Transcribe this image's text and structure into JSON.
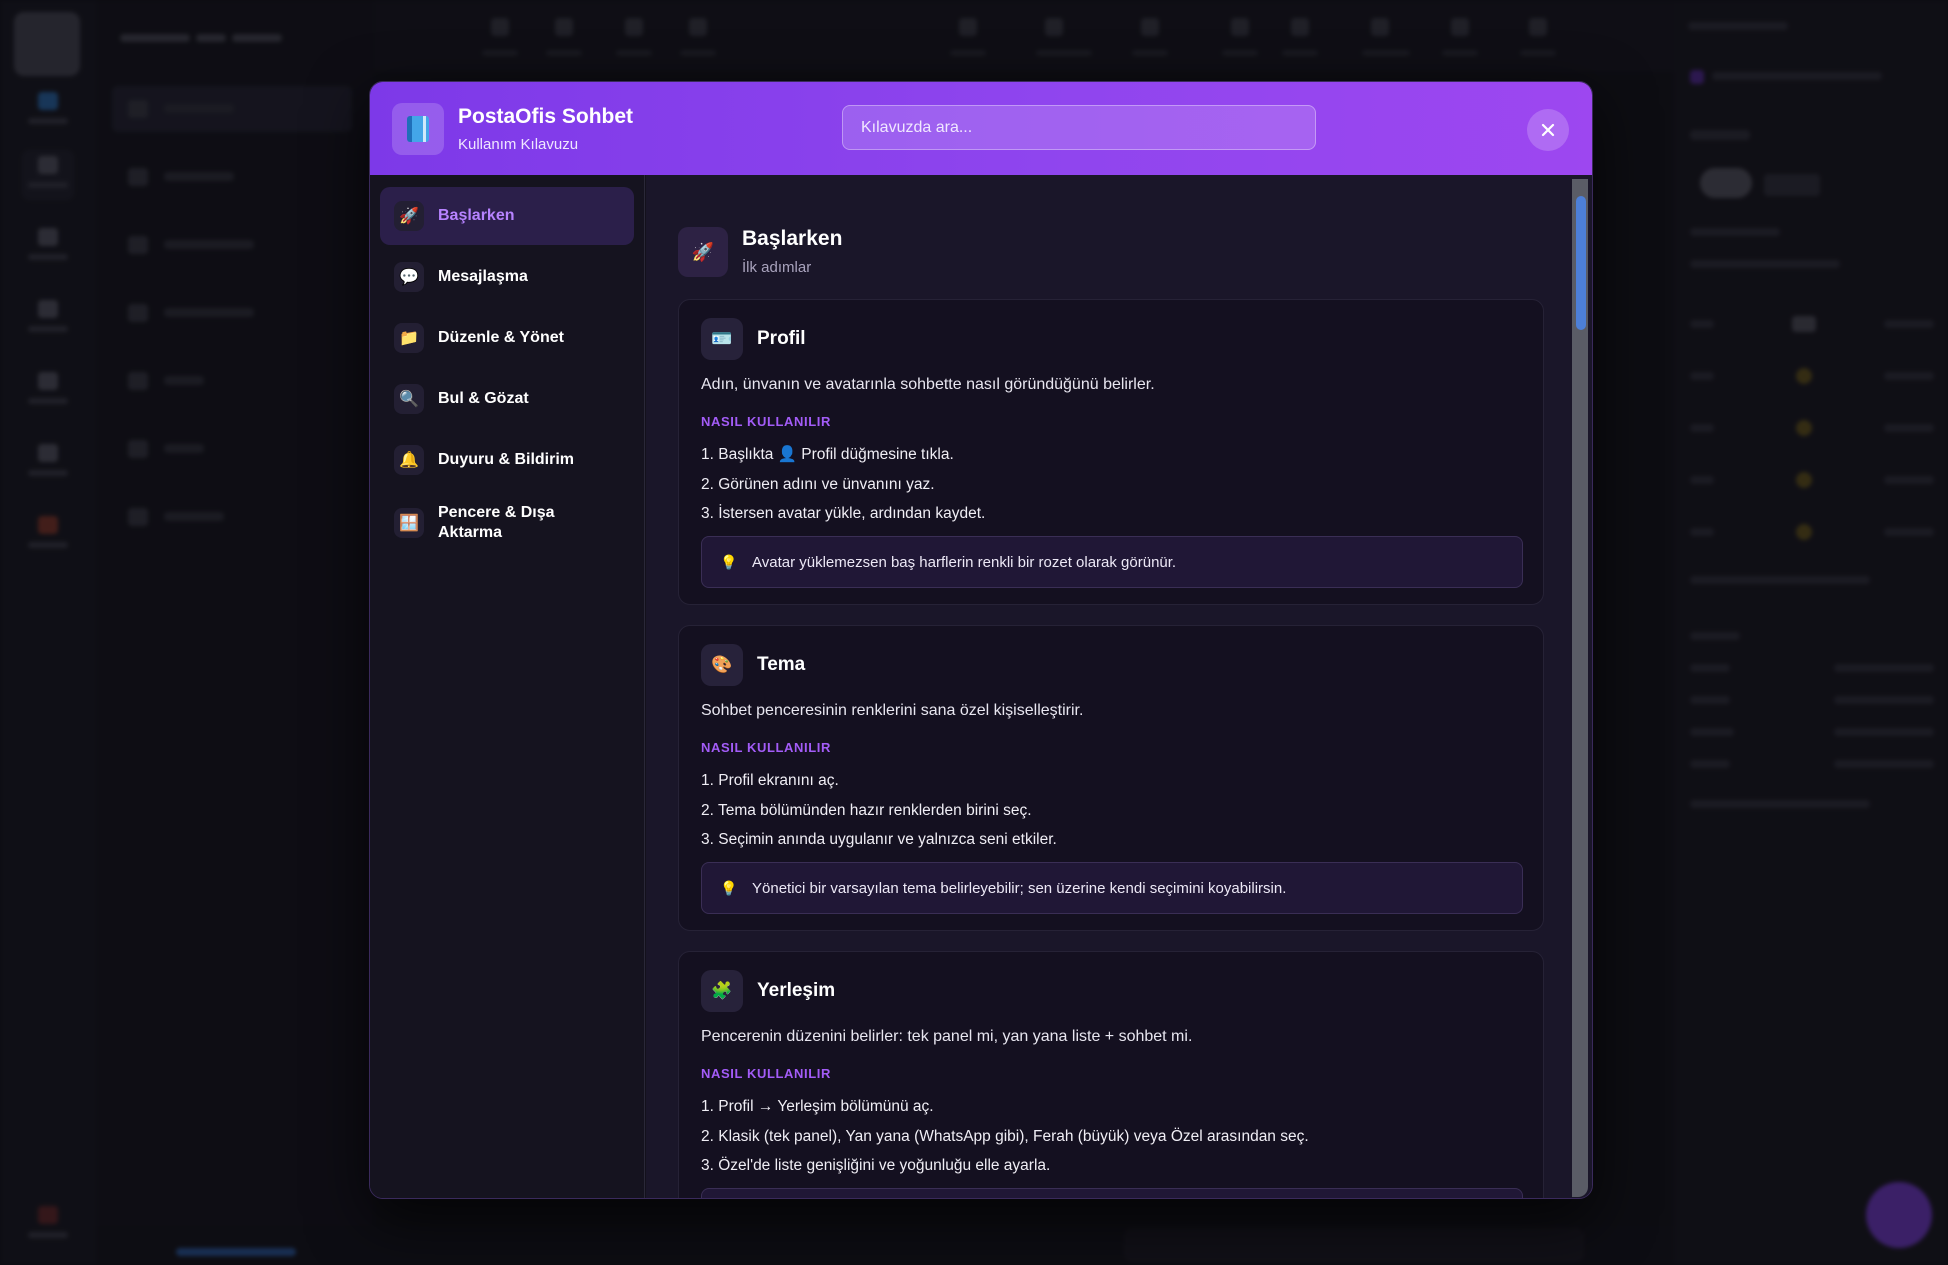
{
  "modal": {
    "title": "PostaOfis Sohbet",
    "subtitle": "Kullanım Kılavuzu",
    "search_placeholder": "Kılavuzda ara...",
    "close_icon": "close-icon",
    "app_icon": "book-icon"
  },
  "nav": [
    {
      "label": "Başlarken",
      "icon": "rocket-icon",
      "glyph": "🚀",
      "active": true
    },
    {
      "label": "Mesajlaşma",
      "icon": "speech-bubble-icon",
      "glyph": "💬",
      "active": false
    },
    {
      "label": "Düzenle & Yönet",
      "icon": "folder-icon",
      "glyph": "📁",
      "active": false
    },
    {
      "label": "Bul & Gözat",
      "icon": "magnifier-icon",
      "glyph": "🔍",
      "active": false
    },
    {
      "label": "Duyuru & Bildirim",
      "icon": "bell-icon",
      "glyph": "🔔",
      "active": false
    },
    {
      "label": "Pencere & Dışa Aktarma",
      "icon": "window-icon",
      "glyph": "🪟",
      "active": false
    }
  ],
  "section": {
    "title": "Başlarken",
    "subtitle": "İlk adımlar",
    "icon": "rocket-icon",
    "glyph": "🚀"
  },
  "cards": [
    {
      "title": "Profil",
      "icon": "id-card-icon",
      "glyph": "🪪",
      "description": "Adın, ünvanın ve avatarınla sohbette nasıl göründüğünü belirler.",
      "howto_label": "NASIL KULLANILIR",
      "steps": [
        "1. Başlıkta 👤 Profil düğmesine tıkla.",
        "2. Görünen adını ve ünvanını yaz.",
        "3. İstersen avatar yükle, ardından kaydet."
      ],
      "tip_icon": "lightbulb-icon",
      "tip": "Avatar yüklemezsen baş harflerin renkli bir rozet olarak görünür."
    },
    {
      "title": "Tema",
      "icon": "palette-icon",
      "glyph": "🎨",
      "description": "Sohbet penceresinin renklerini sana özel kişiselleştirir.",
      "howto_label": "NASIL KULLANILIR",
      "steps": [
        "1. Profil ekranını aç.",
        "2. Tema bölümünden hazır renklerden birini seç.",
        "3. Seçimin anında uygulanır ve yalnızca seni etkiler."
      ],
      "tip_icon": "lightbulb-icon",
      "tip": "Yönetici bir varsayılan tema belirleyebilir; sen üzerine kendi seçimini koyabilirsin."
    },
    {
      "title": "Yerleşim",
      "icon": "puzzle-icon",
      "glyph": "🧩",
      "description": "Pencerenin düzenini belirler: tek panel mi, yan yana liste + sohbet mi.",
      "howto_label": "NASIL KULLANILIR",
      "steps": [
        "1. Profil → Yerleşim bölümünü aç.",
        "2. Klasik (tek panel), Yan yana (WhatsApp gibi), Ferah (büyük) veya Özel arasından seç.",
        "3. Özel'de liste genişliğini ve yoğunluğu elle ayarla."
      ]
    }
  ],
  "colors": {
    "header_gradient_start": "#7d39e8",
    "header_gradient_end": "#9d47f0",
    "accent": "#a35cf7",
    "active_nav_text": "#b783ff",
    "scroll_thumb": "#4d7fd8"
  }
}
